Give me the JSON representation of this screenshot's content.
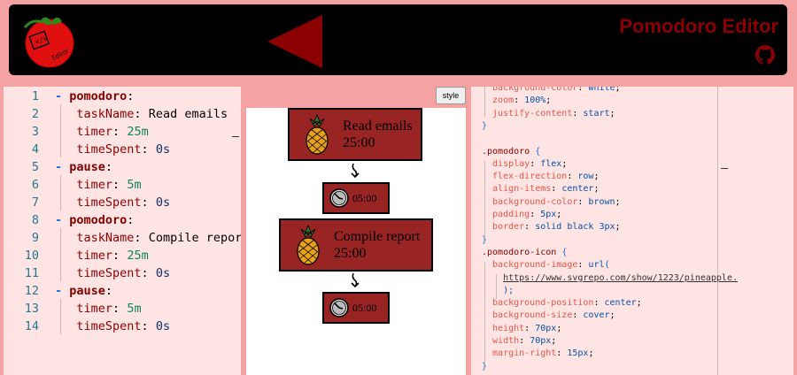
{
  "header": {
    "title": "Pomodoro Editor",
    "logo_text": "Editor"
  },
  "style_button": "style",
  "yaml_lines": [
    {
      "n": "1",
      "indent": 0,
      "dash": true,
      "key": "pomodoro",
      "top": true,
      "val": "",
      "vtype": ""
    },
    {
      "n": "2",
      "indent": 1,
      "dash": false,
      "key": "taskName",
      "top": false,
      "val": "Read emails",
      "vtype": "str"
    },
    {
      "n": "3",
      "indent": 1,
      "dash": false,
      "key": "timer",
      "top": false,
      "val": "25m",
      "vtype": "num"
    },
    {
      "n": "4",
      "indent": 1,
      "dash": false,
      "key": "timeSpent",
      "top": false,
      "val": "0s",
      "vtype": "sub"
    },
    {
      "n": "5",
      "indent": 0,
      "dash": true,
      "key": "pause",
      "top": true,
      "val": "",
      "vtype": ""
    },
    {
      "n": "6",
      "indent": 1,
      "dash": false,
      "key": "timer",
      "top": false,
      "val": "5m",
      "vtype": "num"
    },
    {
      "n": "7",
      "indent": 1,
      "dash": false,
      "key": "timeSpent",
      "top": false,
      "val": "0s",
      "vtype": "sub"
    },
    {
      "n": "8",
      "indent": 0,
      "dash": true,
      "key": "pomodoro",
      "top": true,
      "val": "",
      "vtype": ""
    },
    {
      "n": "9",
      "indent": 1,
      "dash": false,
      "key": "taskName",
      "top": false,
      "val": "Compile report",
      "vtype": "str"
    },
    {
      "n": "10",
      "indent": 1,
      "dash": false,
      "key": "timer",
      "top": false,
      "val": "25m",
      "vtype": "num"
    },
    {
      "n": "11",
      "indent": 1,
      "dash": false,
      "key": "timeSpent",
      "top": false,
      "val": "0s",
      "vtype": "sub"
    },
    {
      "n": "12",
      "indent": 0,
      "dash": true,
      "key": "pause",
      "top": true,
      "val": "",
      "vtype": ""
    },
    {
      "n": "13",
      "indent": 1,
      "dash": false,
      "key": "timer",
      "top": false,
      "val": "5m",
      "vtype": "num"
    },
    {
      "n": "14",
      "indent": 1,
      "dash": false,
      "key": "timeSpent",
      "top": false,
      "val": "0s",
      "vtype": "sub"
    }
  ],
  "preview": {
    "pomodoros": [
      {
        "task": "Read emails",
        "time": "25:00"
      },
      {
        "task": "Compile report",
        "time": "25:00"
      }
    ],
    "pauses": [
      {
        "time": "05:00"
      },
      {
        "time": "05:00"
      }
    ]
  },
  "css_lines": [
    [
      {
        "t": "  background-color",
        "c": "prop"
      },
      {
        "t": ": ",
        "c": ""
      },
      {
        "t": "white",
        "c": "cval"
      },
      {
        "t": ";",
        "c": ""
      }
    ],
    [
      {
        "t": "  zoom",
        "c": "prop"
      },
      {
        "t": ": ",
        "c": ""
      },
      {
        "t": "100%",
        "c": "cval"
      },
      {
        "t": ";",
        "c": ""
      }
    ],
    [
      {
        "t": "  justify-content",
        "c": "prop"
      },
      {
        "t": ": ",
        "c": ""
      },
      {
        "t": "start",
        "c": "cval"
      },
      {
        "t": ";",
        "c": ""
      }
    ],
    [
      {
        "t": "}",
        "c": "brace"
      }
    ],
    [
      {
        "t": "",
        "c": ""
      }
    ],
    [
      {
        "t": ".pomodoro ",
        "c": "sel"
      },
      {
        "t": "{",
        "c": "brace"
      }
    ],
    [
      {
        "t": "  display",
        "c": "prop"
      },
      {
        "t": ": ",
        "c": ""
      },
      {
        "t": "flex",
        "c": "cval"
      },
      {
        "t": ";",
        "c": ""
      }
    ],
    [
      {
        "t": "  flex-direction",
        "c": "prop"
      },
      {
        "t": ": ",
        "c": ""
      },
      {
        "t": "row",
        "c": "cval"
      },
      {
        "t": ";",
        "c": ""
      }
    ],
    [
      {
        "t": "  align-items",
        "c": "prop"
      },
      {
        "t": ": ",
        "c": ""
      },
      {
        "t": "center",
        "c": "cval"
      },
      {
        "t": ";",
        "c": ""
      }
    ],
    [
      {
        "t": "  background-color",
        "c": "prop"
      },
      {
        "t": ": ",
        "c": ""
      },
      {
        "t": "brown",
        "c": "cval"
      },
      {
        "t": ";",
        "c": ""
      }
    ],
    [
      {
        "t": "  padding",
        "c": "prop"
      },
      {
        "t": ": ",
        "c": ""
      },
      {
        "t": "5px",
        "c": "cval"
      },
      {
        "t": ";",
        "c": ""
      }
    ],
    [
      {
        "t": "  border",
        "c": "prop"
      },
      {
        "t": ": ",
        "c": ""
      },
      {
        "t": "solid black 3px",
        "c": "cval"
      },
      {
        "t": ";",
        "c": ""
      }
    ],
    [
      {
        "t": "}",
        "c": "brace"
      }
    ],
    [
      {
        "t": ".pomodoro-icon ",
        "c": "sel"
      },
      {
        "t": "{",
        "c": "brace"
      }
    ],
    [
      {
        "t": "  background-image",
        "c": "prop"
      },
      {
        "t": ": ",
        "c": ""
      },
      {
        "t": "url(",
        "c": "cval"
      }
    ],
    [
      {
        "t": "    ",
        "c": ""
      },
      {
        "t": "https://www.svgrepo.com/show/1223/pineapple.",
        "c": "url"
      }
    ],
    [
      {
        "t": "    ",
        "c": ""
      },
      {
        "t": ");",
        "c": "cval"
      }
    ],
    [
      {
        "t": "  background-position",
        "c": "prop"
      },
      {
        "t": ": ",
        "c": ""
      },
      {
        "t": "center",
        "c": "cval"
      },
      {
        "t": ";",
        "c": ""
      }
    ],
    [
      {
        "t": "  background-size",
        "c": "prop"
      },
      {
        "t": ": ",
        "c": ""
      },
      {
        "t": "cover",
        "c": "cval"
      },
      {
        "t": ";",
        "c": ""
      }
    ],
    [
      {
        "t": "  height",
        "c": "prop"
      },
      {
        "t": ": ",
        "c": ""
      },
      {
        "t": "70px",
        "c": "cval"
      },
      {
        "t": ";",
        "c": ""
      }
    ],
    [
      {
        "t": "  width",
        "c": "prop"
      },
      {
        "t": ": ",
        "c": ""
      },
      {
        "t": "70px",
        "c": "cval"
      },
      {
        "t": ";",
        "c": ""
      }
    ],
    [
      {
        "t": "  margin-right",
        "c": "prop"
      },
      {
        "t": ": ",
        "c": ""
      },
      {
        "t": "15px",
        "c": "cval"
      },
      {
        "t": ";",
        "c": ""
      }
    ],
    [
      {
        "t": "}",
        "c": "brace"
      }
    ]
  ],
  "colors": {
    "background": "#f4a2a2",
    "header": "#000000",
    "accent": "#8b0000",
    "pomodoro_box": "#982424",
    "editor_bg": "#ffe4e4"
  },
  "icons": {
    "logo": "tomato-icon",
    "back": "triangle-left-icon",
    "github": "github-icon",
    "pomodoro": "pineapple-icon",
    "pause": "clock-icon",
    "flow": "arrow-down-icon"
  }
}
